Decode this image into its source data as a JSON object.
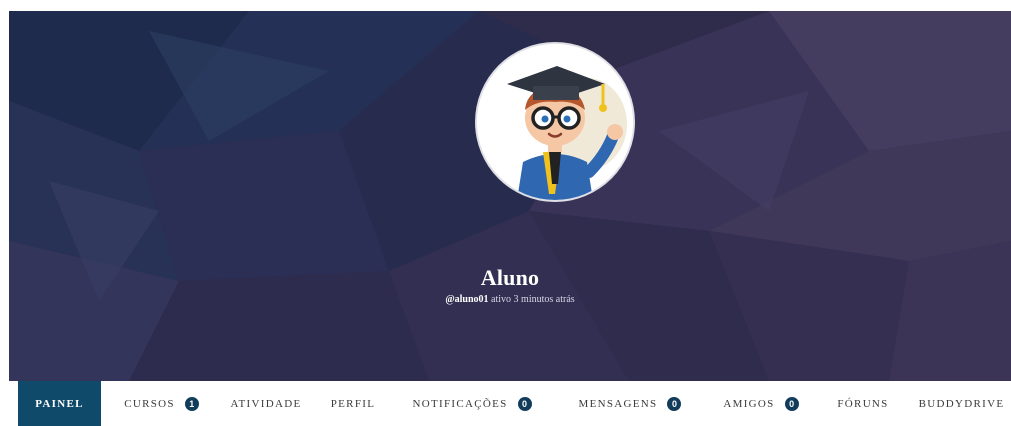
{
  "profile": {
    "name": "Aluno",
    "handle": "@aluno01",
    "status": "ativo 3 minutos atrás"
  },
  "nav": {
    "painel": {
      "label": "PAINEL"
    },
    "cursos": {
      "label": "CURSOS",
      "count": "1"
    },
    "atividade": {
      "label": "ATIVIDADE"
    },
    "perfil": {
      "label": "PERFIL"
    },
    "notificacoes": {
      "label": "NOTIFICAÇÕES",
      "count": "0"
    },
    "mensagens": {
      "label": "MENSAGENS",
      "count": "0"
    },
    "amigos": {
      "label": "AMIGOS",
      "count": "0"
    },
    "foruns": {
      "label": "FÓRUNS"
    },
    "buddydrive": {
      "label": "BUDDYDRIVE"
    }
  },
  "colors": {
    "nav_active_bg": "#0f4a6a",
    "badge_bg": "#113d5b",
    "cover_base": "#2e2a4a"
  },
  "icons": {
    "avatar": "graduate-student-avatar"
  }
}
